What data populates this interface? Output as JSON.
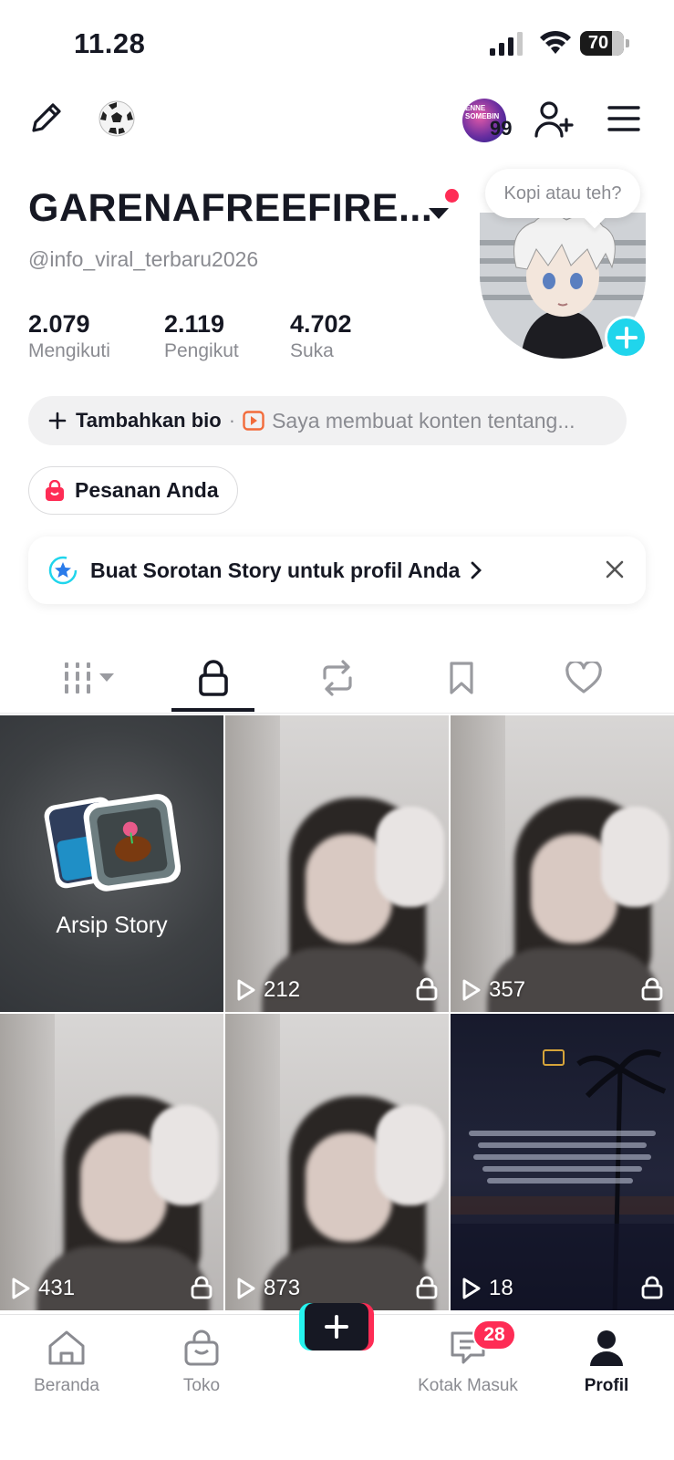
{
  "status_bar": {
    "time": "11.28",
    "battery": "70"
  },
  "top_nav": {
    "avatar_badge": "99"
  },
  "profile": {
    "display_name": "GARENAFREEFIRE...",
    "handle": "@info_viral_terbaru2026",
    "note_bubble": "Kopi atau teh?",
    "stats": [
      {
        "value": "2.079",
        "label": "Mengikuti"
      },
      {
        "value": "2.119",
        "label": "Pengikut"
      },
      {
        "value": "4.702",
        "label": "Suka"
      }
    ],
    "add_bio": "Tambahkan bio",
    "bio_separator": "·",
    "bio_placeholder": "Saya membuat konten tentang..."
  },
  "orders_button": "Pesanan Anda",
  "story_prompt": "Buat Sorotan Story untuk profil Anda",
  "tabs": [
    "videos-grid",
    "private-lock",
    "reposts",
    "favorites",
    "liked"
  ],
  "grid": {
    "archive_label": "Arsip Story",
    "videos": [
      {
        "views": "212"
      },
      {
        "views": "357"
      },
      {
        "views": "431"
      },
      {
        "views": "873"
      },
      {
        "views": "18"
      }
    ]
  },
  "bottom_nav": {
    "items": [
      {
        "label": "Beranda"
      },
      {
        "label": "Toko"
      },
      {
        "label": "Kotak Masuk"
      },
      {
        "label": "Profil"
      }
    ],
    "inbox_badge": "28"
  },
  "colors": {
    "accent_red": "#fe2c55",
    "accent_cyan": "#20d5ec",
    "text": "#161823",
    "muted": "#8a8b91"
  }
}
